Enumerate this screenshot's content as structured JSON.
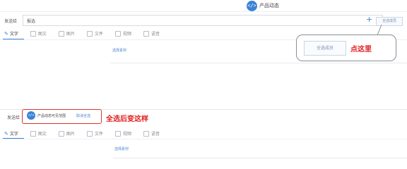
{
  "header": {
    "title": "产品动态",
    "icon": "code-icon",
    "icon_glyph": "</>"
  },
  "top": {
    "recipient_label": "发送给",
    "recipient_value": "报选",
    "plus": "+",
    "select_all": "全选成员",
    "tabs": [
      "文字",
      "图文",
      "图片",
      "文件",
      "视频",
      "语音"
    ],
    "active_tab": 0,
    "choose_material": "选择素材"
  },
  "callout": {
    "button": "全选成员",
    "note": "点这里"
  },
  "bottom": {
    "recipient_label": "发送给",
    "chip_icon_glyph": "</>",
    "chip_text": "产品动态可见范围",
    "chip_cancel": "取消全选",
    "note": "全选后变这样",
    "tabs": [
      "文字",
      "图文",
      "图片",
      "文件",
      "视频",
      "语音"
    ],
    "choose_material": "选择素材"
  },
  "colors": {
    "accent": "#3b82d6",
    "annotation_red": "#e02020"
  }
}
